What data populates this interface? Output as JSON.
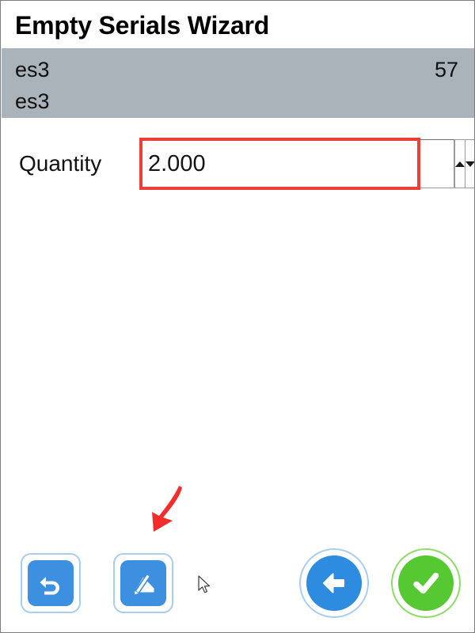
{
  "window": {
    "title": "Empty Serials Wizard"
  },
  "info_band": {
    "line1_left": "es3",
    "line1_right": "57",
    "line2_left": "es3"
  },
  "form": {
    "quantity_label": "Quantity",
    "quantity_value": "2.000",
    "quantity_placeholder": "",
    "stepper_up_icon": "triangle-up-icon",
    "stepper_down_icon": "triangle-down-icon"
  },
  "toolbar": {
    "undo_icon": "undo-arrow-icon",
    "sign_icon": "signature-pen-icon",
    "back_icon": "arrow-left-icon",
    "confirm_icon": "check-circle-icon"
  },
  "annotations": {
    "arrow_icon": "red-pointer-arrow",
    "cursor_icon": "mouse-pointer-icon"
  },
  "colors": {
    "band_gray": "#aab2ba",
    "accent_blue": "#3d8fe0",
    "accent_blue_dark": "#2e8ce0",
    "accent_green": "#56c832",
    "highlight_red": "#ef3e36",
    "button_outline": "#a8cdf0"
  }
}
